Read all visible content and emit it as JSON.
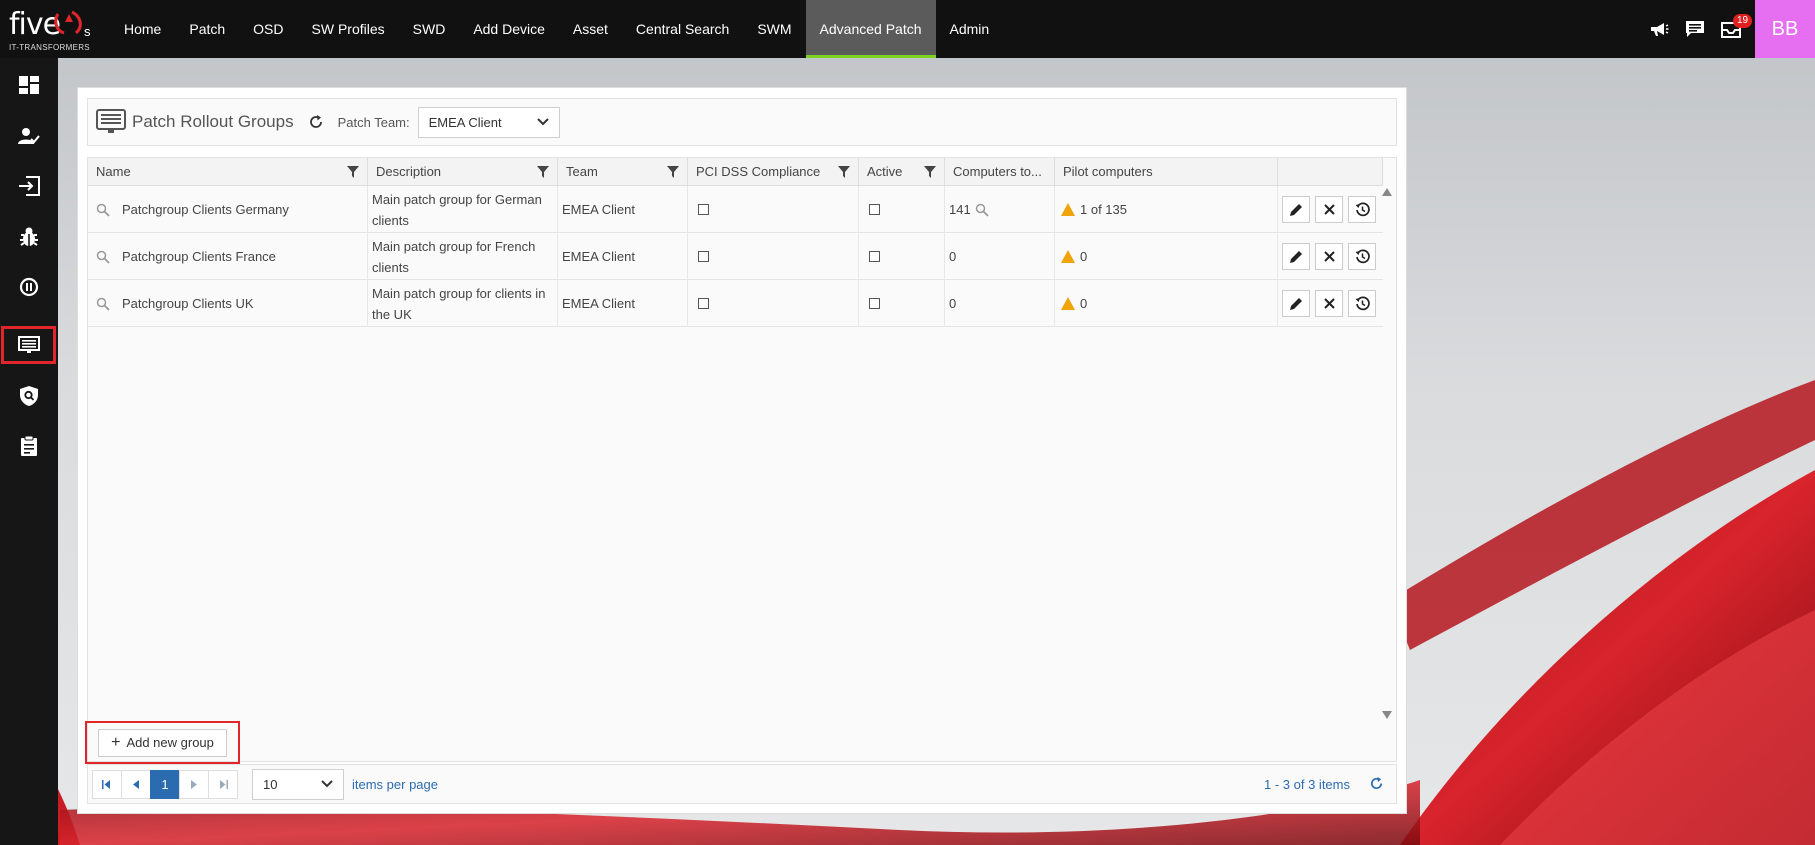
{
  "brand": {
    "name": "five",
    "suffix": "s",
    "tagline": "IT-TRANSFORMERS"
  },
  "nav": [
    {
      "label": "Home"
    },
    {
      "label": "Patch"
    },
    {
      "label": "OSD"
    },
    {
      "label": "SW Profiles"
    },
    {
      "label": "SWD"
    },
    {
      "label": "Add Device"
    },
    {
      "label": "Asset"
    },
    {
      "label": "Central Search"
    },
    {
      "label": "SWM"
    },
    {
      "label": "Advanced Patch",
      "active": true
    },
    {
      "label": "Admin"
    }
  ],
  "top_right": {
    "notification_count": "19",
    "avatar_initials": "BB"
  },
  "sidebar": [
    {
      "icon": "dashboard-icon"
    },
    {
      "icon": "user-check-icon"
    },
    {
      "icon": "login-icon"
    },
    {
      "icon": "bug-icon"
    },
    {
      "icon": "pause-circle-icon"
    },
    {
      "icon": "monitor-list-icon",
      "selected": true
    },
    {
      "icon": "shield-search-icon"
    },
    {
      "icon": "clipboard-icon"
    }
  ],
  "header": {
    "title": "Patch Rollout Groups",
    "team_label": "Patch Team:",
    "team_value": "EMEA Client"
  },
  "table": {
    "columns": [
      "Name",
      "Description",
      "Team",
      "PCI DSS Compliance",
      "Active",
      "Computers to...",
      "Pilot computers"
    ],
    "rows": [
      {
        "name": "Patchgroup Clients Germany",
        "description": "Main patch group for German clients",
        "team": "EMEA Client",
        "computers": "141",
        "pilot": "1 of 135"
      },
      {
        "name": "Patchgroup Clients France",
        "description": "Main patch group for French clients",
        "team": "EMEA Client",
        "computers": "0",
        "pilot": "0"
      },
      {
        "name": "Patchgroup Clients UK",
        "description": "Main patch group for clients in the UK",
        "team": "EMEA Client",
        "computers": "0",
        "pilot": "0"
      }
    ]
  },
  "add_button": "Add new group",
  "pager": {
    "current_page": "1",
    "per_page": "10",
    "per_page_label": "items per page",
    "info": "1 - 3 of 3 items"
  },
  "colors": {
    "accent_red": "#e0262b",
    "active_tab_underline": "#7ed321",
    "link_blue": "#2b6cb0",
    "avatar": "#e66ef0",
    "warning": "#f0a30a"
  }
}
